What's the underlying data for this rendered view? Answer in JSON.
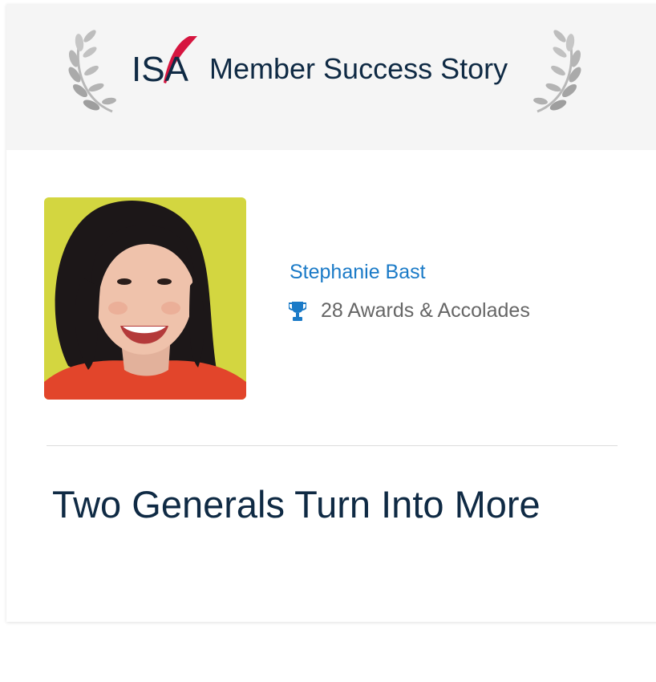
{
  "banner": {
    "logo_text": "ISA",
    "title": "Member Success Story",
    "icons": [
      "laurel-left",
      "laurel-right",
      "quill"
    ]
  },
  "member": {
    "name": "Stephanie Bast",
    "awards_label": "28 Awards & Accolades",
    "awards_icon": "trophy-icon"
  },
  "story": {
    "title": "Two Generals Turn Into More"
  },
  "colors": {
    "banner_bg": "#f5f5f5",
    "navy": "#0f2a44",
    "link_blue": "#1a7ac7",
    "accent_red": "#d6153f",
    "muted_text": "#666666"
  }
}
